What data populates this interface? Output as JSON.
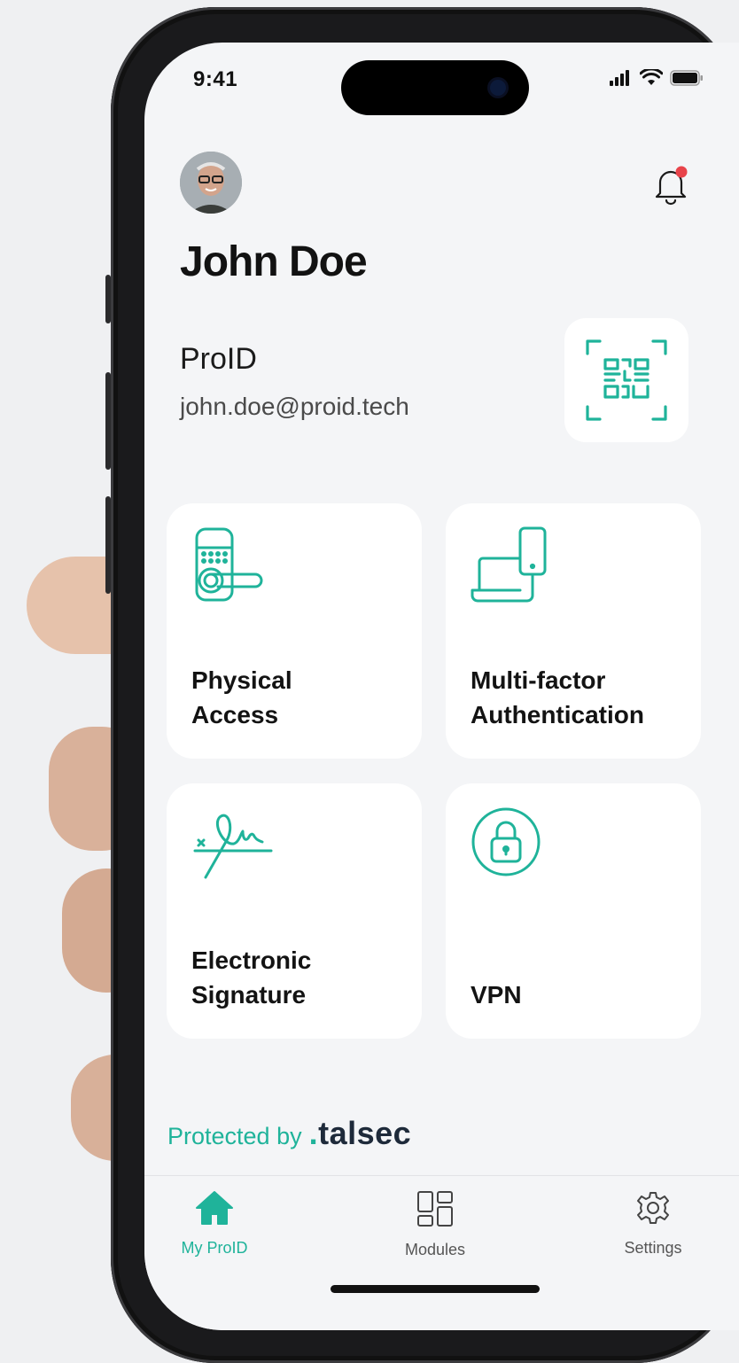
{
  "status_bar": {
    "time": "9:41"
  },
  "profile": {
    "name": "John Doe",
    "organization": "ProID",
    "email": "john.doe@proid.tech"
  },
  "modules": [
    {
      "id": "physical-access",
      "line1": "Physical",
      "line2": "Access",
      "icon": "door-lock-icon"
    },
    {
      "id": "mfa",
      "line1": "Multi-factor",
      "line2": "Authentication",
      "icon": "devices-icon"
    },
    {
      "id": "esignature",
      "line1": "Electronic",
      "line2": "Signature",
      "icon": "signature-icon"
    },
    {
      "id": "vpn",
      "line1": "",
      "line2": "VPN",
      "icon": "lock-icon"
    }
  ],
  "footer": {
    "protected_by": "Protected by",
    "brand": "talsec"
  },
  "tabs": [
    {
      "label": "My ProID",
      "icon": "home-icon",
      "active": true
    },
    {
      "label": "Modules",
      "icon": "modules-grid-icon",
      "active": false
    },
    {
      "label": "Settings",
      "icon": "gear-icon",
      "active": false
    }
  ],
  "colors": {
    "accent": "#1fb39a",
    "notification": "#e8434a",
    "text": "#131313"
  }
}
